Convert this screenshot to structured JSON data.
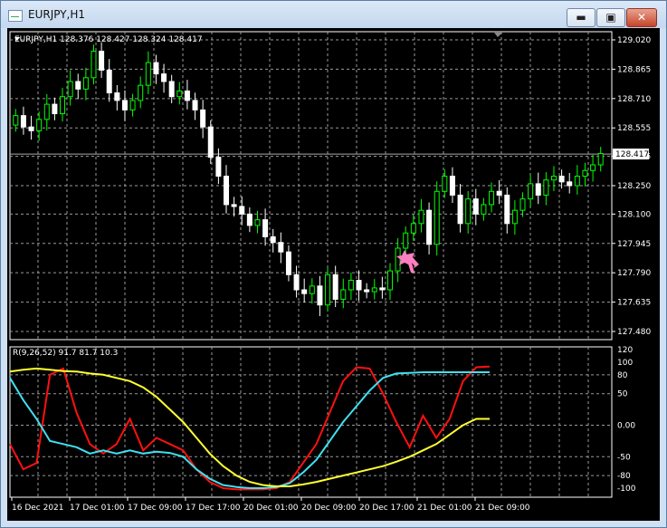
{
  "window": {
    "title": "EURJPY,H1",
    "min_glyph": "▬",
    "max_glyph": "▣",
    "close_glyph": "✕"
  },
  "info": {
    "symbol_line": "EURJPY,H1  128.376  128.427  128.324  128.417",
    "indicator_line": "R(9,26,52)  91.7  81.7  10.3"
  },
  "colors": {
    "bull": "#00ff00",
    "bear": "#ffffff",
    "grid": "#9a9a9a",
    "red": "#ff1010",
    "cyan": "#40e0f0",
    "yellow": "#ffff30",
    "arrow": "#ff7ec0"
  },
  "chart_data": [
    {
      "type": "candlestick",
      "price_ticks": [
        "129.020",
        "128.865",
        "128.710",
        "128.555",
        "128.405",
        "128.250",
        "128.100",
        "127.945",
        "127.790",
        "127.635",
        "127.480"
      ],
      "price_ylim": [
        127.48,
        129.02
      ],
      "current_price_label": "128.417",
      "current_price": 128.417,
      "close": [
        128.62,
        128.56,
        128.54,
        128.6,
        128.68,
        128.63,
        128.72,
        128.8,
        128.76,
        128.82,
        128.96,
        128.86,
        128.74,
        128.7,
        128.65,
        128.7,
        128.78,
        128.9,
        128.84,
        128.8,
        128.72,
        128.75,
        128.7,
        128.65,
        128.56,
        128.4,
        128.3,
        128.15,
        128.14,
        128.1,
        128.04,
        128.07,
        127.98,
        127.95,
        127.9,
        127.78,
        127.7,
        127.68,
        127.72,
        127.62,
        127.78,
        127.65,
        127.7,
        127.75,
        127.7,
        127.69,
        127.71,
        127.7,
        127.8,
        127.92,
        128.0,
        128.05,
        128.12,
        127.94,
        128.22,
        128.3,
        128.2,
        128.05,
        128.18,
        128.1,
        128.15,
        128.22,
        128.2,
        128.05,
        128.12,
        128.18,
        128.26,
        128.2,
        128.28,
        128.3,
        128.27,
        128.25,
        128.3,
        128.33,
        128.36,
        128.42
      ]
    },
    {
      "type": "line",
      "ylim": [
        -110,
        120
      ],
      "y_ticks": [
        120,
        100,
        80,
        50,
        0.0,
        -50,
        -80,
        -100
      ],
      "y_tick_labels": [
        "120",
        "100",
        "80",
        "50",
        "0.00",
        "-50",
        "-80",
        "-100"
      ],
      "x_tick_labels": [
        "16 Dec 2021",
        "17 Dec 01:00",
        "17 Dec 09:00",
        "17 Dec 17:00",
        "20 Dec 01:00",
        "20 Dec 09:00",
        "20 Dec 17:00",
        "21 Dec 01:00",
        "21 Dec 09:00"
      ],
      "series": [
        {
          "color": "red",
          "values": [
            -30,
            -70,
            -60,
            80,
            90,
            20,
            -30,
            -45,
            -30,
            10,
            -40,
            -20,
            -30,
            -40,
            -70,
            -90,
            -100,
            -102,
            -102,
            -102,
            -100,
            -90,
            -60,
            -30,
            20,
            70,
            92,
            90,
            50,
            5,
            -35,
            15,
            -20,
            10,
            70,
            92,
            93
          ]
        },
        {
          "color": "cyan",
          "values": [
            75,
            40,
            10,
            -25,
            -30,
            -35,
            -45,
            -40,
            -45,
            -40,
            -45,
            -42,
            -44,
            -50,
            -70,
            -85,
            -95,
            -98,
            -100,
            -100,
            -98,
            -92,
            -75,
            -55,
            -25,
            5,
            30,
            55,
            75,
            82,
            83,
            84,
            84,
            84,
            84,
            84,
            84
          ]
        },
        {
          "color": "yellow",
          "values": [
            85,
            88,
            90,
            88,
            86,
            85,
            82,
            80,
            75,
            70,
            60,
            45,
            25,
            5,
            -20,
            -45,
            -65,
            -80,
            -90,
            -95,
            -97,
            -97,
            -94,
            -90,
            -85,
            -80,
            -75,
            -70,
            -65,
            -58,
            -50,
            -40,
            -30,
            -15,
            0,
            10,
            10
          ]
        }
      ]
    }
  ]
}
